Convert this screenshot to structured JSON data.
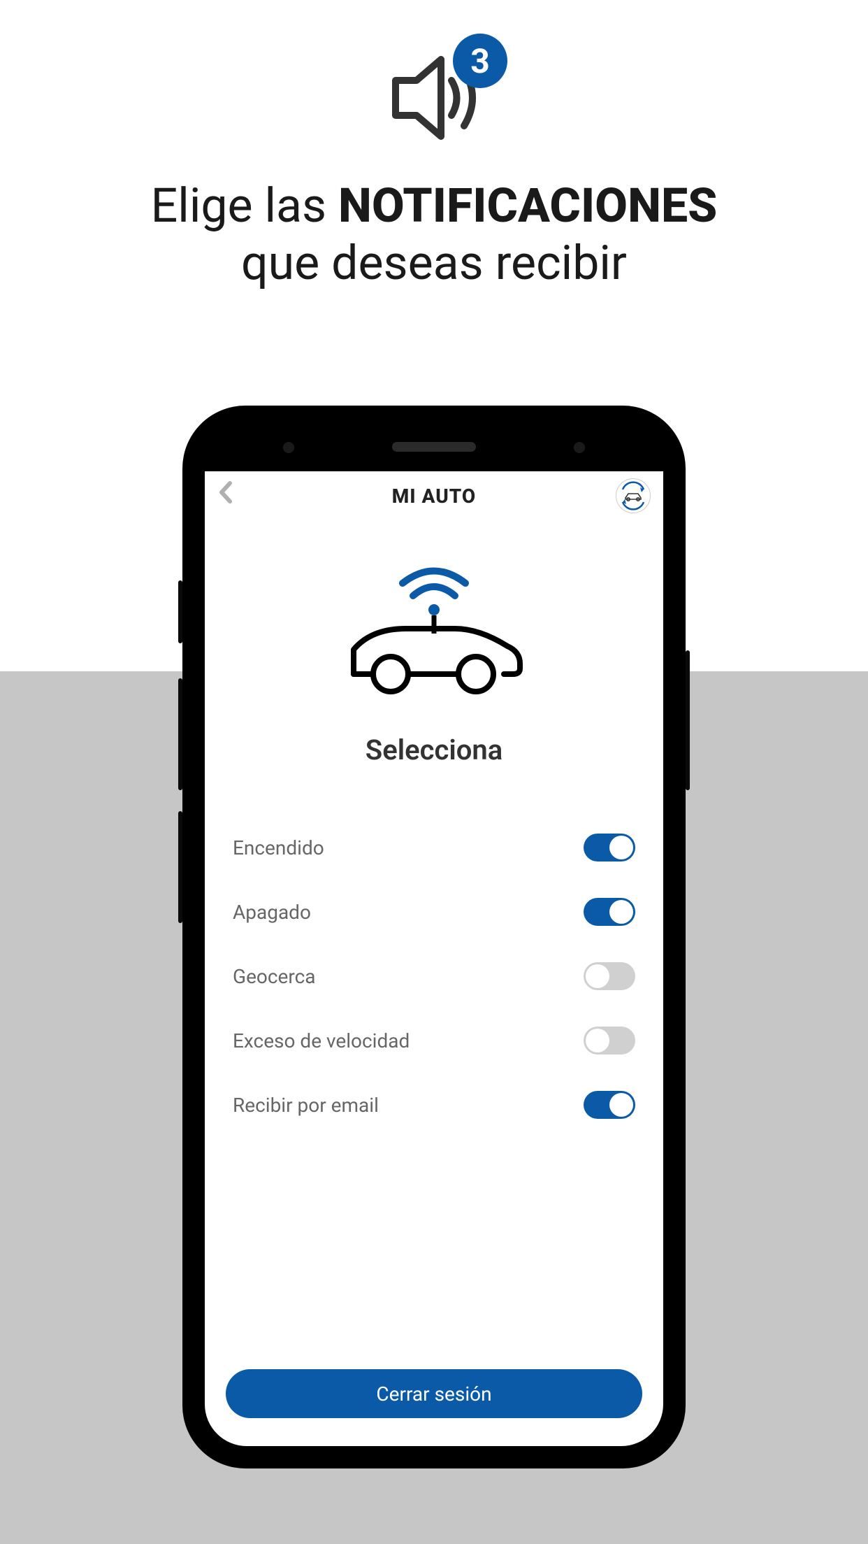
{
  "hero": {
    "badge_count": "3",
    "headline_prefix": "Elige las ",
    "headline_strong": "NOTIFICACIONES",
    "headline_suffix": "que deseas recibir"
  },
  "app": {
    "header_title": "MI AUTO",
    "section_title": "Selecciona",
    "logout_label": "Cerrar sesión"
  },
  "toggles": [
    {
      "label": "Encendido",
      "on": true
    },
    {
      "label": "Apagado",
      "on": true
    },
    {
      "label": "Geocerca",
      "on": false
    },
    {
      "label": "Exceso de velocidad",
      "on": false
    },
    {
      "label": "Recibir por email",
      "on": true
    }
  ]
}
